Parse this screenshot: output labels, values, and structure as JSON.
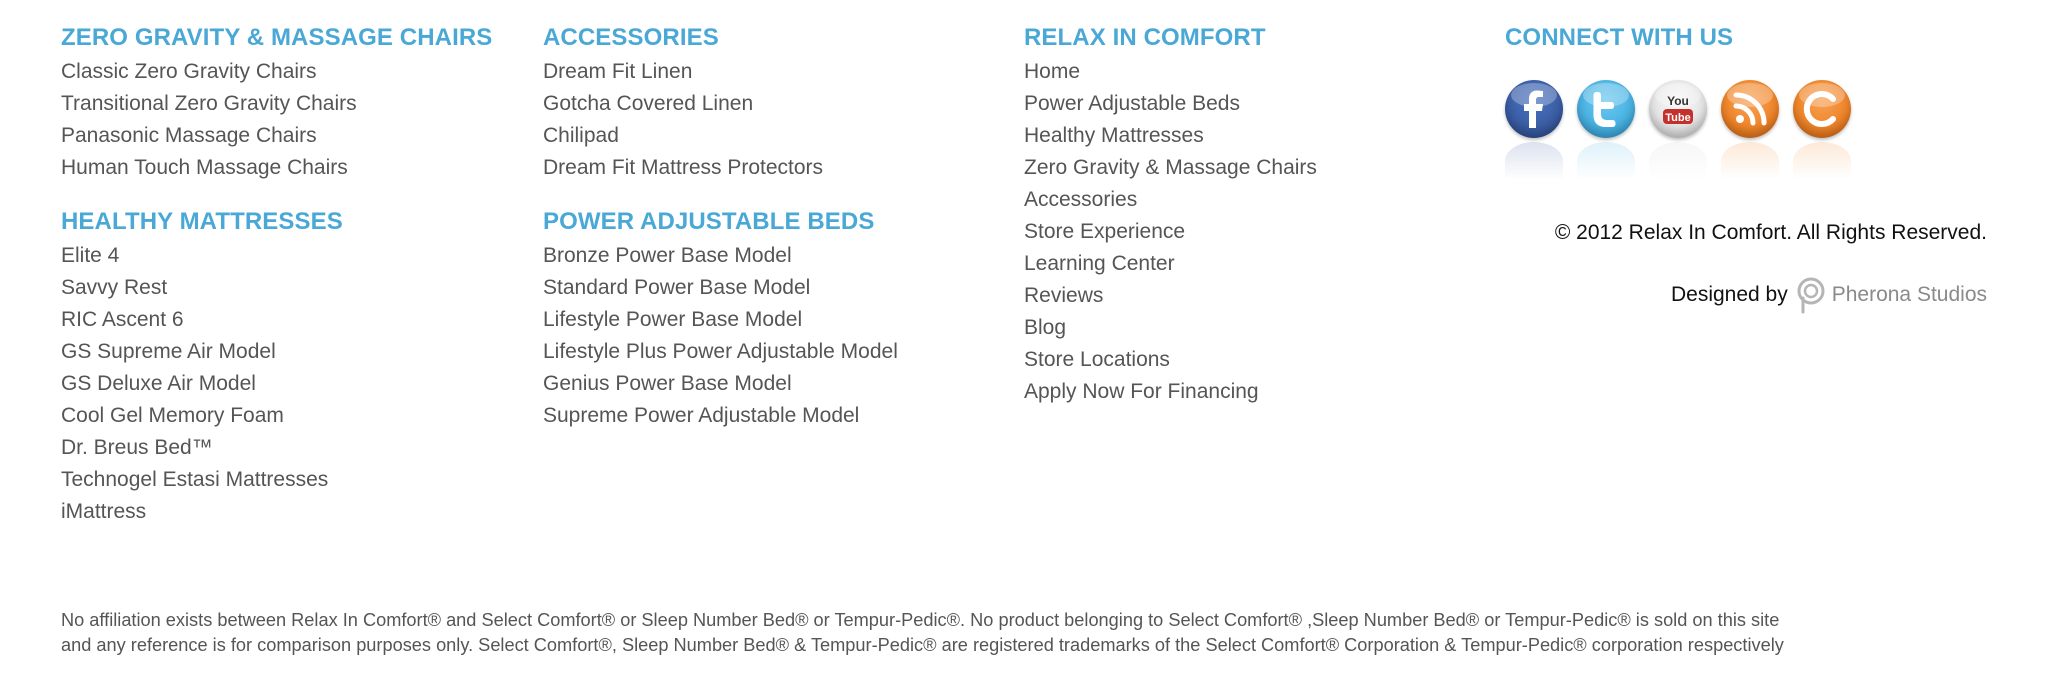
{
  "columns": [
    {
      "sections": [
        {
          "title": "ZERO GRAVITY & MASSAGE CHAIRS",
          "links": [
            "Classic Zero Gravity Chairs",
            "Transitional Zero Gravity Chairs",
            "Panasonic Massage Chairs",
            "Human Touch Massage Chairs"
          ]
        },
        {
          "title": "HEALTHY MATTRESSES",
          "links": [
            "Elite 4",
            "Savvy Rest",
            "RIC Ascent 6",
            "GS Supreme Air Model",
            "GS Deluxe Air Model",
            "Cool Gel Memory Foam",
            "Dr. Breus Bed™",
            "Technogel Estasi Mattresses",
            "iMattress"
          ]
        }
      ]
    },
    {
      "sections": [
        {
          "title": "ACCESSORIES",
          "links": [
            "Dream Fit Linen",
            "Gotcha Covered Linen",
            "Chilipad",
            "Dream Fit Mattress Protectors"
          ]
        },
        {
          "title": "POWER ADJUSTABLE BEDS",
          "links": [
            "Bronze Power Base Model",
            "Standard Power Base Model",
            "Lifestyle Power Base Model",
            "Lifestyle Plus Power Adjustable Model",
            "Genius Power Base Model",
            "Supreme Power Adjustable Model"
          ]
        }
      ]
    },
    {
      "sections": [
        {
          "title": "RELAX IN COMFORT",
          "links": [
            "Home",
            "Power Adjustable Beds",
            "Healthy Mattresses",
            "Zero Gravity & Massage Chairs",
            "Accessories",
            "Store Experience",
            "Learning Center",
            "Reviews",
            "Blog",
            "Store Locations",
            "Apply Now For Financing"
          ]
        }
      ]
    }
  ],
  "connect": {
    "title": "CONNECT WITH US",
    "icons": [
      {
        "name": "facebook-icon",
        "glyph": "f",
        "color": "#3b5ea6",
        "color_dark": "#27447f"
      },
      {
        "name": "twitter-icon",
        "glyph": "t",
        "color": "#4ab3e3",
        "color_dark": "#2a8fc2"
      },
      {
        "name": "youtube-icon",
        "glyph": "You Tube",
        "color": "#e6e6e6",
        "color_dark": "#bdbdbd"
      },
      {
        "name": "rss-icon",
        "glyph": "rss",
        "color": "#f0862a",
        "color_dark": "#cc5f10"
      },
      {
        "name": "blog-icon",
        "glyph": "C",
        "color": "#f0862a",
        "color_dark": "#cc5f10"
      }
    ]
  },
  "copyright": "© 2012 Relax In Comfort. All Rights Reserved.",
  "designed_by": {
    "label": "Designed by",
    "studio": "Pherona Studios"
  },
  "disclaimer": {
    "line1": "No affiliation exists between Relax In Comfort® and Select Comfort® or Sleep Number Bed® or Tempur-Pedic®. No product belonging to Select Comfort® ,Sleep Number Bed® or Tempur-Pedic® is sold on this site",
    "line2": "and any reference is for comparison purposes only. Select Comfort®, Sleep Number Bed® & Tempur-Pedic® are registered trademarks of the Select Comfort® Corporation & Tempur-Pedic® corporation respectively"
  },
  "colors": {
    "heading": "#4aa8d6",
    "link": "#555555",
    "text_dark": "#111111"
  }
}
